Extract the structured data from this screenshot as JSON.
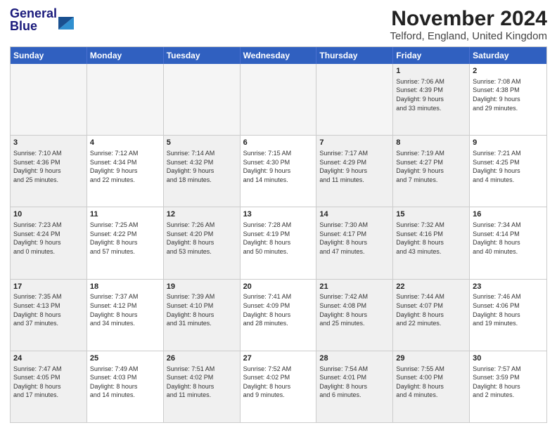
{
  "logo": {
    "line1": "General",
    "line2": "Blue"
  },
  "title": "November 2024",
  "subtitle": "Telford, England, United Kingdom",
  "weekdays": [
    "Sunday",
    "Monday",
    "Tuesday",
    "Wednesday",
    "Thursday",
    "Friday",
    "Saturday"
  ],
  "rows": [
    [
      {
        "day": "",
        "info": "",
        "empty": true
      },
      {
        "day": "",
        "info": "",
        "empty": true
      },
      {
        "day": "",
        "info": "",
        "empty": true
      },
      {
        "day": "",
        "info": "",
        "empty": true
      },
      {
        "day": "",
        "info": "",
        "empty": true
      },
      {
        "day": "1",
        "info": "Sunrise: 7:06 AM\nSunset: 4:39 PM\nDaylight: 9 hours\nand 33 minutes.",
        "shaded": true
      },
      {
        "day": "2",
        "info": "Sunrise: 7:08 AM\nSunset: 4:38 PM\nDaylight: 9 hours\nand 29 minutes."
      }
    ],
    [
      {
        "day": "3",
        "info": "Sunrise: 7:10 AM\nSunset: 4:36 PM\nDaylight: 9 hours\nand 25 minutes.",
        "shaded": true
      },
      {
        "day": "4",
        "info": "Sunrise: 7:12 AM\nSunset: 4:34 PM\nDaylight: 9 hours\nand 22 minutes."
      },
      {
        "day": "5",
        "info": "Sunrise: 7:14 AM\nSunset: 4:32 PM\nDaylight: 9 hours\nand 18 minutes.",
        "shaded": true
      },
      {
        "day": "6",
        "info": "Sunrise: 7:15 AM\nSunset: 4:30 PM\nDaylight: 9 hours\nand 14 minutes."
      },
      {
        "day": "7",
        "info": "Sunrise: 7:17 AM\nSunset: 4:29 PM\nDaylight: 9 hours\nand 11 minutes.",
        "shaded": true
      },
      {
        "day": "8",
        "info": "Sunrise: 7:19 AM\nSunset: 4:27 PM\nDaylight: 9 hours\nand 7 minutes.",
        "shaded": true
      },
      {
        "day": "9",
        "info": "Sunrise: 7:21 AM\nSunset: 4:25 PM\nDaylight: 9 hours\nand 4 minutes."
      }
    ],
    [
      {
        "day": "10",
        "info": "Sunrise: 7:23 AM\nSunset: 4:24 PM\nDaylight: 9 hours\nand 0 minutes.",
        "shaded": true
      },
      {
        "day": "11",
        "info": "Sunrise: 7:25 AM\nSunset: 4:22 PM\nDaylight: 8 hours\nand 57 minutes."
      },
      {
        "day": "12",
        "info": "Sunrise: 7:26 AM\nSunset: 4:20 PM\nDaylight: 8 hours\nand 53 minutes.",
        "shaded": true
      },
      {
        "day": "13",
        "info": "Sunrise: 7:28 AM\nSunset: 4:19 PM\nDaylight: 8 hours\nand 50 minutes."
      },
      {
        "day": "14",
        "info": "Sunrise: 7:30 AM\nSunset: 4:17 PM\nDaylight: 8 hours\nand 47 minutes.",
        "shaded": true
      },
      {
        "day": "15",
        "info": "Sunrise: 7:32 AM\nSunset: 4:16 PM\nDaylight: 8 hours\nand 43 minutes.",
        "shaded": true
      },
      {
        "day": "16",
        "info": "Sunrise: 7:34 AM\nSunset: 4:14 PM\nDaylight: 8 hours\nand 40 minutes."
      }
    ],
    [
      {
        "day": "17",
        "info": "Sunrise: 7:35 AM\nSunset: 4:13 PM\nDaylight: 8 hours\nand 37 minutes.",
        "shaded": true
      },
      {
        "day": "18",
        "info": "Sunrise: 7:37 AM\nSunset: 4:12 PM\nDaylight: 8 hours\nand 34 minutes."
      },
      {
        "day": "19",
        "info": "Sunrise: 7:39 AM\nSunset: 4:10 PM\nDaylight: 8 hours\nand 31 minutes.",
        "shaded": true
      },
      {
        "day": "20",
        "info": "Sunrise: 7:41 AM\nSunset: 4:09 PM\nDaylight: 8 hours\nand 28 minutes."
      },
      {
        "day": "21",
        "info": "Sunrise: 7:42 AM\nSunset: 4:08 PM\nDaylight: 8 hours\nand 25 minutes.",
        "shaded": true
      },
      {
        "day": "22",
        "info": "Sunrise: 7:44 AM\nSunset: 4:07 PM\nDaylight: 8 hours\nand 22 minutes.",
        "shaded": true
      },
      {
        "day": "23",
        "info": "Sunrise: 7:46 AM\nSunset: 4:06 PM\nDaylight: 8 hours\nand 19 minutes."
      }
    ],
    [
      {
        "day": "24",
        "info": "Sunrise: 7:47 AM\nSunset: 4:05 PM\nDaylight: 8 hours\nand 17 minutes.",
        "shaded": true
      },
      {
        "day": "25",
        "info": "Sunrise: 7:49 AM\nSunset: 4:03 PM\nDaylight: 8 hours\nand 14 minutes."
      },
      {
        "day": "26",
        "info": "Sunrise: 7:51 AM\nSunset: 4:02 PM\nDaylight: 8 hours\nand 11 minutes.",
        "shaded": true
      },
      {
        "day": "27",
        "info": "Sunrise: 7:52 AM\nSunset: 4:02 PM\nDaylight: 8 hours\nand 9 minutes."
      },
      {
        "day": "28",
        "info": "Sunrise: 7:54 AM\nSunset: 4:01 PM\nDaylight: 8 hours\nand 6 minutes.",
        "shaded": true
      },
      {
        "day": "29",
        "info": "Sunrise: 7:55 AM\nSunset: 4:00 PM\nDaylight: 8 hours\nand 4 minutes.",
        "shaded": true
      },
      {
        "day": "30",
        "info": "Sunrise: 7:57 AM\nSunset: 3:59 PM\nDaylight: 8 hours\nand 2 minutes."
      }
    ]
  ]
}
